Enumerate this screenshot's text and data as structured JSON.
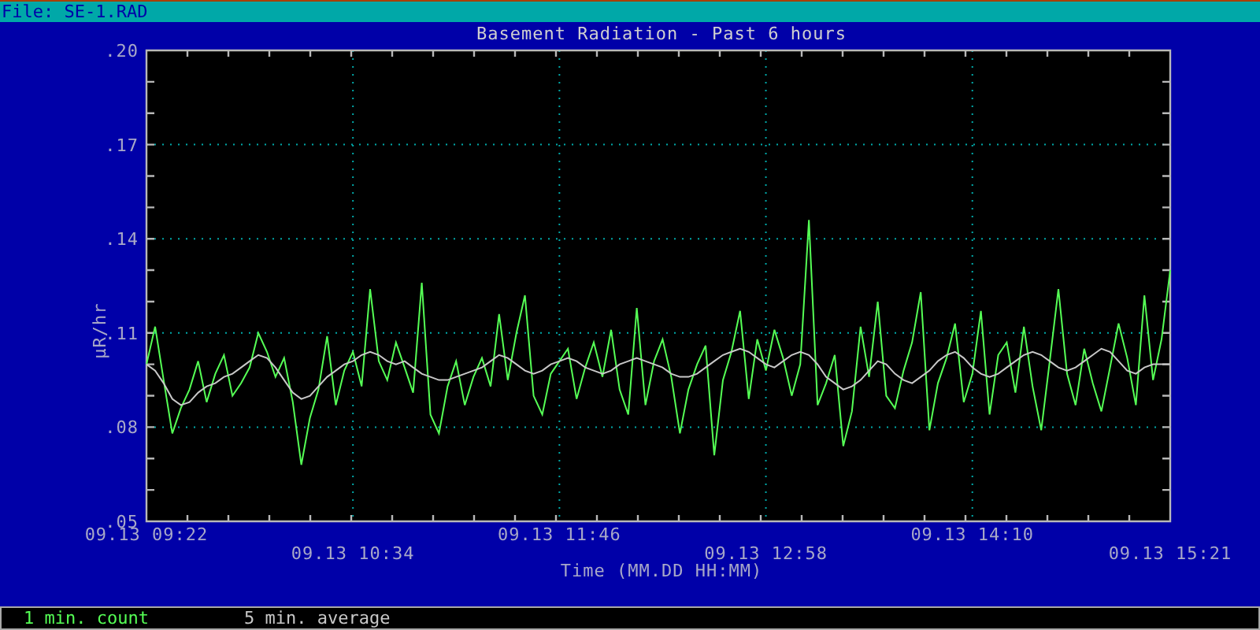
{
  "top_bar": {
    "file": "File: SE-1.RAD"
  },
  "chart": {
    "chart_data": {
      "type": "line",
      "title": "Basement Radiation - Past 6 hours",
      "xlabel": "Time (MM.DD HH:MM)",
      "ylabel": "μR/hr",
      "grid": true,
      "ylim": [
        0.05,
        0.2
      ],
      "categories": [
        "09.13 09:22",
        null,
        null,
        null,
        null,
        null,
        null,
        null,
        null,
        null,
        null,
        null,
        null,
        null,
        null,
        null,
        null,
        null,
        null,
        null,
        null,
        null,
        null,
        null,
        "09.13 10:34",
        null,
        null,
        null,
        null,
        null,
        null,
        null,
        null,
        null,
        null,
        null,
        null,
        null,
        null,
        null,
        null,
        null,
        null,
        null,
        null,
        null,
        null,
        null,
        "09.13 11:46",
        null,
        null,
        null,
        null,
        null,
        null,
        null,
        null,
        null,
        null,
        null,
        null,
        null,
        null,
        null,
        null,
        null,
        null,
        null,
        null,
        null,
        null,
        null,
        "09.13 12:58",
        null,
        null,
        null,
        null,
        null,
        null,
        null,
        null,
        null,
        null,
        null,
        null,
        null,
        null,
        null,
        null,
        null,
        null,
        null,
        null,
        null,
        null,
        null,
        "09.13 14:10",
        null,
        null,
        null,
        null,
        null,
        null,
        null,
        null,
        null,
        null,
        null,
        null,
        null,
        null,
        null,
        null,
        null,
        null,
        null,
        null,
        null,
        null,
        "09.13 15:21"
      ],
      "yticks": [
        {
          "value": 0.05,
          "label": ".05"
        },
        {
          "value": 0.08,
          "label": ".08"
        },
        {
          "value": 0.11,
          "label": ".11"
        },
        {
          "value": 0.14,
          "label": ".14"
        },
        {
          "value": 0.17,
          "label": ".17"
        },
        {
          "value": 0.2,
          "label": ".20"
        }
      ],
      "series": [
        {
          "name": "1 min. count",
          "color": "#55ff55",
          "values": [
            0.1,
            0.112,
            0.095,
            0.078,
            0.086,
            0.092,
            0.101,
            0.088,
            0.097,
            0.103,
            0.09,
            0.094,
            0.099,
            0.11,
            0.104,
            0.096,
            0.102,
            0.088,
            0.068,
            0.083,
            0.092,
            0.109,
            0.087,
            0.098,
            0.104,
            0.093,
            0.124,
            0.101,
            0.095,
            0.107,
            0.099,
            0.091,
            0.126,
            0.084,
            0.078,
            0.093,
            0.101,
            0.087,
            0.096,
            0.102,
            0.093,
            0.116,
            0.095,
            0.11,
            0.122,
            0.09,
            0.084,
            0.097,
            0.101,
            0.105,
            0.089,
            0.099,
            0.107,
            0.096,
            0.111,
            0.092,
            0.084,
            0.118,
            0.087,
            0.101,
            0.108,
            0.096,
            0.078,
            0.092,
            0.1,
            0.106,
            0.071,
            0.095,
            0.104,
            0.117,
            0.089,
            0.108,
            0.098,
            0.111,
            0.102,
            0.09,
            0.1,
            0.146,
            0.087,
            0.094,
            0.103,
            0.074,
            0.085,
            0.112,
            0.096,
            0.12,
            0.09,
            0.086,
            0.098,
            0.107,
            0.123,
            0.079,
            0.094,
            0.102,
            0.113,
            0.088,
            0.097,
            0.117,
            0.084,
            0.103,
            0.107,
            0.091,
            0.112,
            0.093,
            0.079,
            0.101,
            0.124,
            0.097,
            0.087,
            0.105,
            0.094,
            0.085,
            0.099,
            0.113,
            0.102,
            0.087,
            0.122,
            0.095,
            0.108,
            0.13
          ]
        },
        {
          "name": "5 min. average",
          "color": "#c8c8c8",
          "values": [
            0.1,
            0.098,
            0.094,
            0.089,
            0.087,
            0.088,
            0.091,
            0.093,
            0.094,
            0.096,
            0.097,
            0.099,
            0.101,
            0.103,
            0.102,
            0.099,
            0.095,
            0.091,
            0.089,
            0.09,
            0.093,
            0.096,
            0.098,
            0.1,
            0.101,
            0.103,
            0.104,
            0.103,
            0.101,
            0.1,
            0.101,
            0.099,
            0.097,
            0.096,
            0.095,
            0.095,
            0.096,
            0.097,
            0.098,
            0.099,
            0.101,
            0.103,
            0.102,
            0.1,
            0.098,
            0.097,
            0.098,
            0.1,
            0.101,
            0.102,
            0.101,
            0.099,
            0.098,
            0.097,
            0.098,
            0.1,
            0.101,
            0.102,
            0.101,
            0.1,
            0.099,
            0.097,
            0.096,
            0.096,
            0.097,
            0.099,
            0.101,
            0.103,
            0.104,
            0.105,
            0.104,
            0.102,
            0.1,
            0.099,
            0.101,
            0.103,
            0.104,
            0.103,
            0.1,
            0.096,
            0.094,
            0.092,
            0.093,
            0.095,
            0.098,
            0.101,
            0.1,
            0.097,
            0.095,
            0.094,
            0.096,
            0.098,
            0.101,
            0.103,
            0.104,
            0.102,
            0.099,
            0.097,
            0.096,
            0.097,
            0.099,
            0.101,
            0.103,
            0.104,
            0.103,
            0.101,
            0.099,
            0.098,
            0.099,
            0.101,
            0.103,
            0.105,
            0.104,
            0.101,
            0.098,
            0.097,
            0.099,
            0.1,
            0.1,
            0.1
          ]
        }
      ]
    }
  }
}
